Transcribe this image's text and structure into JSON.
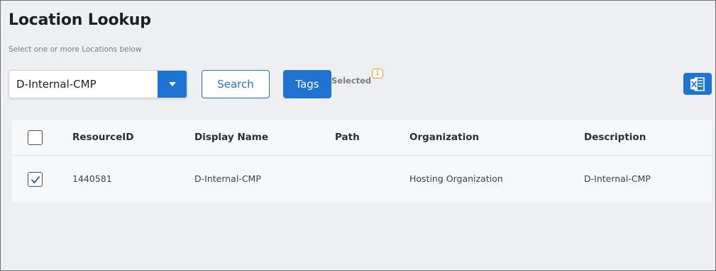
{
  "page": {
    "title": "Location Lookup",
    "subtitle": "Select one or more Locations below"
  },
  "search_bar": {
    "location_value": "D-Internal-CMP",
    "dropdown_icon": "caret-down-icon",
    "search_label": "Search",
    "tags_label": "Tags",
    "selected_label": "Selected",
    "selected_count": "1",
    "export_icon": "excel-icon"
  },
  "colors": {
    "accent": "#1f73d3",
    "badge": "#f0a21a",
    "background": "#eeeff2"
  },
  "table": {
    "columns": [
      "ResourceID",
      "Display Name",
      "Path",
      "Organization",
      "Description"
    ],
    "rows": [
      {
        "checked": true,
        "resource_id": "1440581",
        "display_name": "D-Internal-CMP",
        "path": "",
        "organization": "Hosting Organization",
        "description": "D-Internal-CMP"
      }
    ]
  }
}
